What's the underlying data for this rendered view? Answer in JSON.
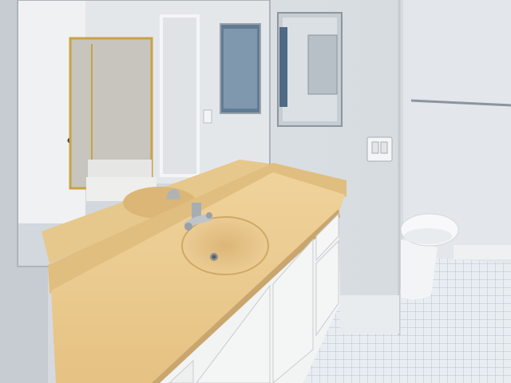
{
  "scene": {
    "description_label": "",
    "watermark_text": "",
    "colors": {
      "wall": "#e6e9ec",
      "wall_shadow": "#cfd4d9",
      "countertop": "#e9c98e",
      "countertop_edge": "#c9a66d",
      "sink": "#e3c184",
      "cabinet": "#f4f4f2",
      "floor_tile": "#e8edf2",
      "grout": "#b9c2cc",
      "mirror_tint": "#d8dde0",
      "door_left": "#c7ccd2",
      "toilet": "#f5f7f8"
    },
    "objects": [
      "vanity-mirror",
      "countertop",
      "sink-basin",
      "faucet",
      "cabinet-doors",
      "medicine-cabinet",
      "light-switch",
      "toilet",
      "towel-bar",
      "tile-floor",
      "reflected-shower"
    ]
  }
}
